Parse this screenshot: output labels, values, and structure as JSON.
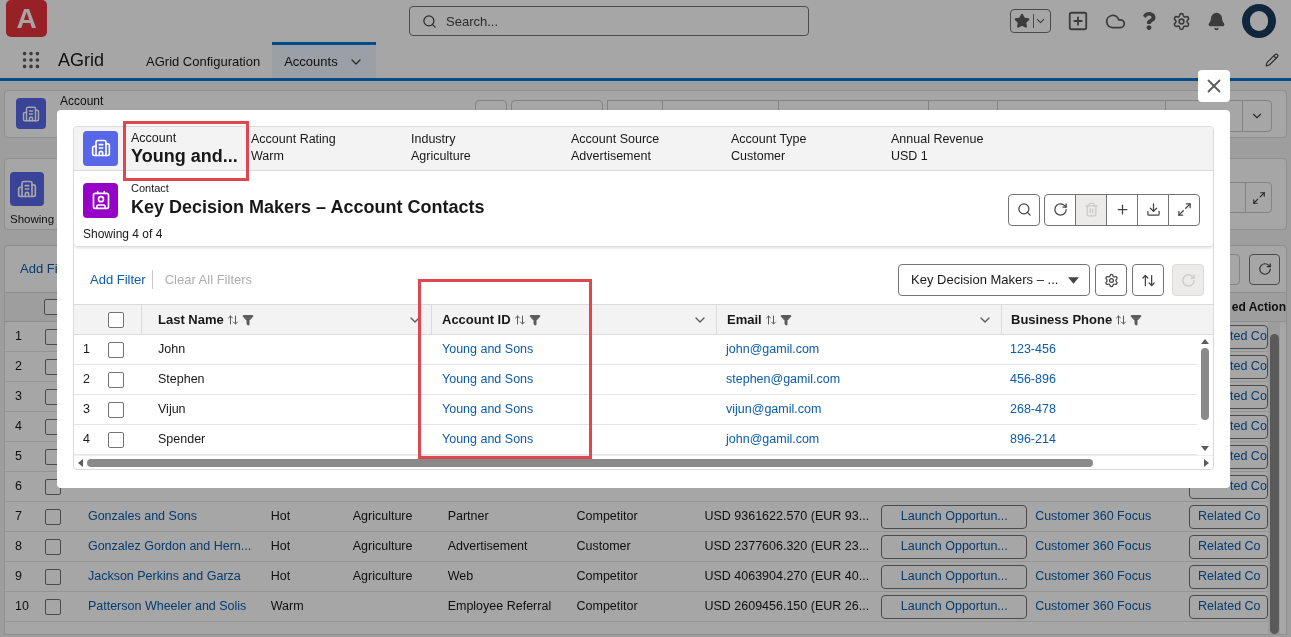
{
  "app": {
    "logo_text": "A",
    "search_placeholder": "Search...",
    "name": "AGrid"
  },
  "nav_tabs": [
    {
      "label": "AGrid Configuration",
      "selected": false
    },
    {
      "label": "Accounts",
      "selected": true
    }
  ],
  "background": {
    "record_label": "Account",
    "list_summary": "Showing",
    "filter_link": "Add Fi",
    "actions_header": "ed Action",
    "rows": [
      {
        "number": "1",
        "kind": "covered",
        "checked": false,
        "related": "ted Co"
      },
      {
        "number": "2",
        "kind": "covered",
        "checked": false,
        "related": "ted Co"
      },
      {
        "number": "3",
        "kind": "covered",
        "checked": false,
        "related": "ted Co"
      },
      {
        "number": "4",
        "kind": "covered",
        "checked": false,
        "related": "ted Co"
      },
      {
        "number": "5",
        "kind": "covered",
        "checked": false,
        "related": "ted Co"
      },
      {
        "number": "6",
        "kind": "covered",
        "checked": false,
        "related": "ted Co"
      },
      {
        "number": "7",
        "kind": "full",
        "checked": false,
        "account": "Gonzales and Sons",
        "rating": "Hot",
        "industry": "Agriculture",
        "source": "Partner",
        "type": "Competitor",
        "revenue": "USD 9361622.570 (EUR 93...",
        "launch": "Launch Opportun...",
        "focus": "Customer 360 Focus",
        "related": "Related Co"
      },
      {
        "number": "8",
        "kind": "full",
        "checked": false,
        "account": "Gonzalez Gordon and Hern...",
        "rating": "Hot",
        "industry": "Agriculture",
        "source": "Advertisement",
        "type": "Customer",
        "revenue": "USD 2377606.320 (EUR 23...",
        "launch": "Launch Opportun...",
        "focus": "Customer 360 Focus",
        "related": "Related Co"
      },
      {
        "number": "9",
        "kind": "full",
        "checked": false,
        "account": "Jackson Perkins and Garza",
        "rating": "Hot",
        "industry": "Agriculture",
        "source": "Web",
        "type": "Competitor",
        "revenue": "USD 4063904.270 (EUR 40...",
        "launch": "Launch Opportun...",
        "focus": "Customer 360 Focus",
        "related": "Related Co"
      },
      {
        "number": "10",
        "kind": "full",
        "checked": false,
        "account": "Patterson Wheeler and Solis",
        "rating": "Warm",
        "source": "Employee Referral",
        "type": "Competitor",
        "revenue": "USD 2609456.150 (EUR 26...",
        "launch": "Launch Opportun...",
        "focus": "Customer 360 Focus",
        "related": "Related Co"
      }
    ],
    "select_all": {
      "checked": false
    }
  },
  "modal": {
    "record": {
      "object": "Account",
      "name": "Young and...",
      "fields": [
        {
          "label": "Account Rating",
          "value": "Warm"
        },
        {
          "label": "Industry",
          "value": "Agriculture"
        },
        {
          "label": "Account Source",
          "value": "Advertisement"
        },
        {
          "label": "Account Type",
          "value": "Customer"
        },
        {
          "label": "Annual Revenue",
          "value": "USD 1"
        }
      ]
    },
    "list": {
      "object": "Contact",
      "title": "Key Decision Makers – Account Contacts",
      "summary": "Showing 4 of 4",
      "toolbar": [
        {
          "kind": "search",
          "disabled": false
        },
        {
          "kind": "refresh",
          "disabled": false
        },
        {
          "kind": "delete",
          "disabled": true
        },
        {
          "kind": "add",
          "disabled": false
        },
        {
          "kind": "download",
          "disabled": false
        },
        {
          "kind": "expand",
          "disabled": false
        }
      ],
      "filter_link": "Add Filter",
      "clear_filters": {
        "label": "Clear All Filters",
        "disabled": true
      },
      "view": "Key Decision Makers – ...",
      "filter_tools": [
        {
          "kind": "settings",
          "disabled": false
        },
        {
          "kind": "sort",
          "disabled": false
        },
        {
          "kind": "refresh",
          "disabled": true
        }
      ],
      "select_all": {
        "checked": false
      },
      "columns": [
        "Last Name",
        "Account ID",
        "Email",
        "Business Phone"
      ],
      "rows": [
        {
          "number": "1",
          "checked": false,
          "last_name": "John",
          "account": "Young and Sons",
          "email": "john@gamil.com",
          "phone": "123-456"
        },
        {
          "number": "2",
          "checked": false,
          "last_name": "Stephen",
          "account": "Young and Sons",
          "email": "stephen@gamil.com",
          "phone": "456-896"
        },
        {
          "number": "3",
          "checked": false,
          "last_name": "Vijun",
          "account": "Young and Sons",
          "email": "vijun@gamil.com",
          "phone": "268-478"
        },
        {
          "number": "4",
          "checked": false,
          "last_name": "Spender",
          "account": "Young and Sons",
          "email": "john@gamil.com",
          "phone": "896-214"
        }
      ]
    }
  }
}
